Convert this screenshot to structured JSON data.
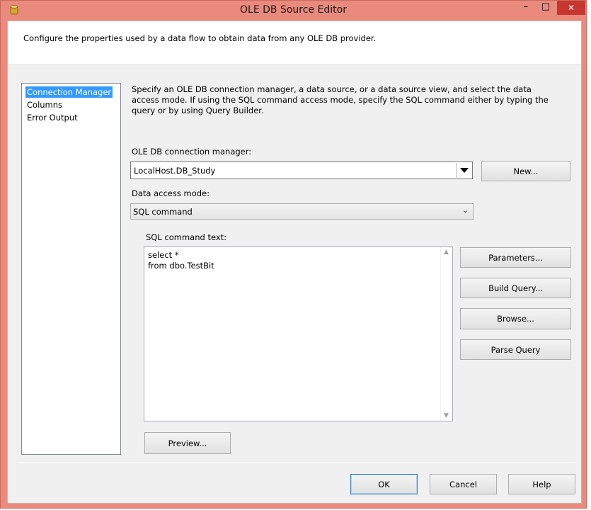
{
  "window": {
    "title": "OLE DB Source Editor",
    "controls": {
      "minimize": "–",
      "maximize": "□",
      "close": "✕"
    }
  },
  "header": {
    "description": "Configure the properties used by a data flow to obtain data from any OLE DB provider."
  },
  "nav": {
    "items": [
      {
        "label": "Connection Manager",
        "selected": true
      },
      {
        "label": "Columns",
        "selected": false
      },
      {
        "label": "Error Output",
        "selected": false
      }
    ]
  },
  "main": {
    "description": "Specify an OLE DB connection manager, a data source, or a data source view, and select the data access mode. If using the SQL command access mode, specify the SQL command either by typing the query or by using Query Builder.",
    "connection_manager": {
      "label": "OLE DB connection manager:",
      "value": "LocalHost.DB_Study",
      "new_button": "New..."
    },
    "access_mode": {
      "label": "Data access mode:",
      "value": "SQL command"
    },
    "sql_command": {
      "label": "SQL command text:",
      "text": "select *\nfrom dbo.TestBit"
    },
    "buttons": {
      "parameters": "Parameters...",
      "build_query": "Build Query...",
      "browse": "Browse...",
      "parse_query": "Parse Query",
      "preview": "Preview..."
    }
  },
  "footer": {
    "ok": "OK",
    "cancel": "Cancel",
    "help": "Help"
  },
  "colors": {
    "frame": "#ea8a7d",
    "selection": "#3399ff",
    "close_button": "#c7372f"
  }
}
